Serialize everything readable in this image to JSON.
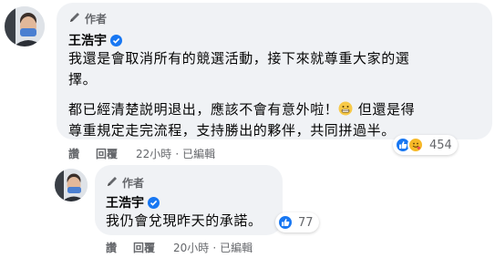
{
  "comments": [
    {
      "author_badge": "作者",
      "name": "王浩宇",
      "paragraph1_line1": "我還是會取消所有的競選活動，接下來就尊重大家的選",
      "paragraph1_line2": "擇。",
      "paragraph2_line1_a": "都已經清楚説明退出，應該不會有意外啦！",
      "paragraph2_line1_b": "但還是得",
      "paragraph2_line2": "尊重規定走完流程，支持勝出的夥伴，共同拼過半。",
      "inline_emoji": "grimacing-face-icon",
      "reaction_count": "454",
      "actions": {
        "like": "讚",
        "reply": "回覆",
        "time": "22小時",
        "edited": "已編輯"
      }
    },
    {
      "author_badge": "作者",
      "name": "王浩宇",
      "text": "我仍會兌現昨天的承諾。",
      "reaction_count": "77",
      "actions": {
        "like": "讚",
        "reply": "回覆",
        "time": "20小時",
        "edited": "已編輯"
      }
    }
  ],
  "colors": {
    "bubble": "#f0f2f5",
    "meta_text": "#65676b",
    "like_blue": "#1877f2"
  }
}
